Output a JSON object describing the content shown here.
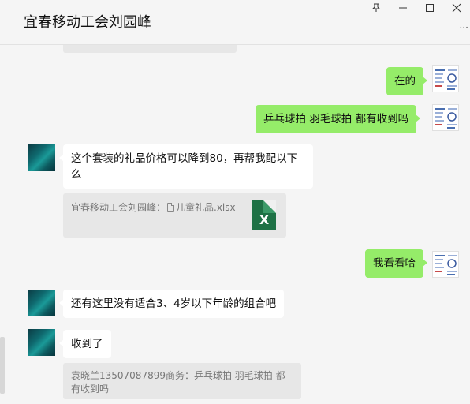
{
  "header": {
    "title": "宜春移动工会刘园峰",
    "more_icon": "more-icon"
  },
  "window_controls": {
    "pin_icon": "pin-icon",
    "minimize_icon": "minimize-icon",
    "maximize_icon": "maximize-icon",
    "close_icon": "close-icon"
  },
  "messages": [
    {
      "sender": "me",
      "text": "在的"
    },
    {
      "sender": "me",
      "text": "乒乓球拍  羽毛球拍 都有收到吗"
    },
    {
      "sender": "other",
      "text": "这个套装的礼品价格可以降到80，再帮我配以下么"
    },
    {
      "sender": "other-quote",
      "quote_sender": "宜春移动工会刘园峰：",
      "file_name": "儿童礼品.xlsx",
      "file_icon": "excel-file-icon",
      "file_icon_letter": "X"
    },
    {
      "sender": "me",
      "text": "我看看哈"
    },
    {
      "sender": "other",
      "text": "还有这里没有适合3、4岁以下年龄的组合吧"
    },
    {
      "sender": "other",
      "text": "收到了"
    },
    {
      "sender": "other-quote",
      "quote_text": "袁晓兰13507087899商务：乒乓球拍  羽毛球拍 都有收到吗"
    }
  ],
  "colors": {
    "my_bubble": "#95ec69",
    "other_bubble": "#ffffff",
    "quote_bg": "#e7e7e7",
    "excel_green": "#1e7145"
  }
}
